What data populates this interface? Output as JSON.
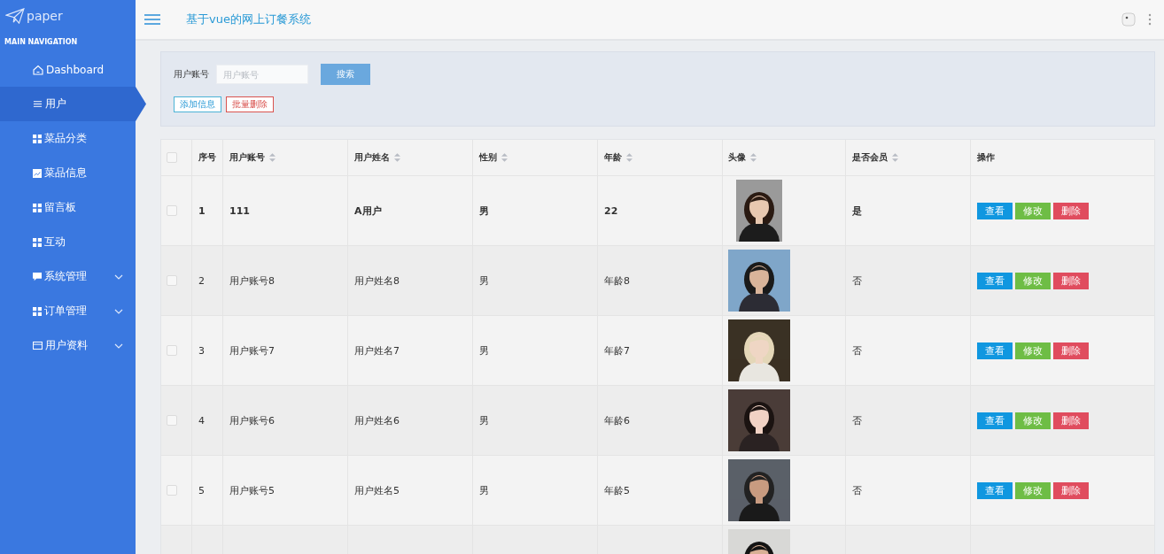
{
  "brand": "paper",
  "nav_heading": "MAIN NAVIGATION",
  "sidebar": {
    "items": [
      {
        "label": "Dashboard",
        "selected": false,
        "kind": "link"
      },
      {
        "label": "用户",
        "selected": true,
        "kind": "link"
      },
      {
        "label": "菜品分类",
        "selected": false,
        "kind": "link"
      },
      {
        "label": "菜品信息",
        "selected": false,
        "kind": "link"
      },
      {
        "label": "留言板",
        "selected": false,
        "kind": "link"
      },
      {
        "label": "互动",
        "selected": false,
        "kind": "link"
      },
      {
        "label": "系统管理",
        "selected": false,
        "kind": "group"
      },
      {
        "label": "订单管理",
        "selected": false,
        "kind": "group"
      },
      {
        "label": "用户资料",
        "selected": false,
        "kind": "group"
      }
    ]
  },
  "header": {
    "title": "基于vue的网上订餐系统"
  },
  "search": {
    "label": "用户账号",
    "placeholder": "用户账号",
    "button": "搜索"
  },
  "actions": [
    "添加信息",
    "批量删除"
  ],
  "table": {
    "select_all_checked": false,
    "columns": [
      {
        "label": "序号",
        "sortable": false
      },
      {
        "label": "用户账号",
        "sortable": true
      },
      {
        "label": "用户姓名",
        "sortable": true
      },
      {
        "label": "性别",
        "sortable": true
      },
      {
        "label": "年龄",
        "sortable": true
      },
      {
        "label": "头像",
        "sortable": true
      },
      {
        "label": "是否会员",
        "sortable": true
      },
      {
        "label": "操作",
        "sortable": false
      }
    ],
    "rows": [
      {
        "checked": false,
        "bold": true,
        "cells": [
          "1",
          "111",
          "A用户",
          "男",
          "22"
        ],
        "member": "是",
        "buttons": [
          "查看",
          "修改",
          "删除"
        ]
      },
      {
        "checked": false,
        "bold": false,
        "cells": [
          "2",
          "用户账号8",
          "用户姓名8",
          "男",
          "年龄8"
        ],
        "member": "否",
        "buttons": [
          "查看",
          "修改",
          "删除"
        ]
      },
      {
        "checked": false,
        "bold": false,
        "cells": [
          "3",
          "用户账号7",
          "用户姓名7",
          "男",
          "年龄7"
        ],
        "member": "否",
        "buttons": [
          "查看",
          "修改",
          "删除"
        ]
      },
      {
        "checked": false,
        "bold": false,
        "cells": [
          "4",
          "用户账号6",
          "用户姓名6",
          "男",
          "年龄6"
        ],
        "member": "否",
        "buttons": [
          "查看",
          "修改",
          "删除"
        ]
      },
      {
        "checked": false,
        "bold": false,
        "cells": [
          "5",
          "用户账号5",
          "用户姓名5",
          "男",
          "年龄5"
        ],
        "member": "否",
        "buttons": [
          "查看",
          "修改",
          "删除"
        ]
      }
    ]
  }
}
